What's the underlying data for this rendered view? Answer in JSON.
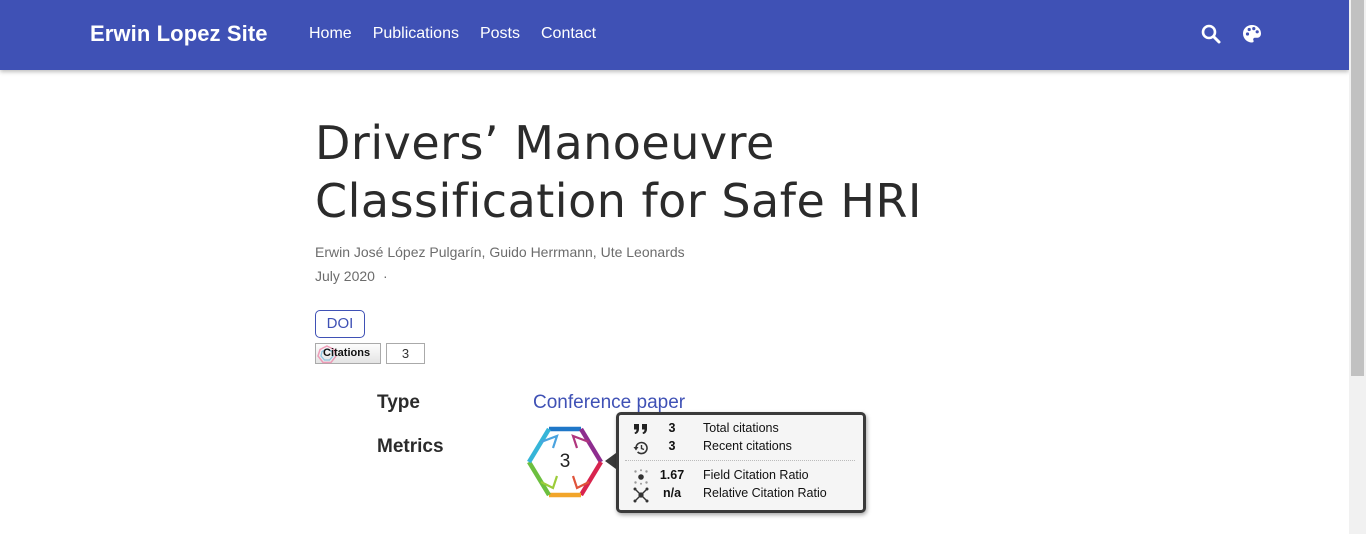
{
  "header": {
    "brand": "Erwin Lopez Site",
    "nav": [
      "Home",
      "Publications",
      "Posts",
      "Contact"
    ],
    "icons": [
      "search-icon",
      "palette-icon"
    ],
    "bg_color": "#3f51b5"
  },
  "publication": {
    "title_line1": "Drivers’ Manoeuvre",
    "title_line2": "Classification for Safe HRI",
    "authors": "Erwin José López Pulgarín, Guido Herrmann, Ute Leonards",
    "date": "July 2020",
    "date_sep": "·",
    "doi_label": "DOI"
  },
  "citation_badge": {
    "label": "Citations",
    "count": "3"
  },
  "meta": {
    "type_label": "Type",
    "type_value": "Conference paper",
    "metrics_label": "Metrics"
  },
  "metrics_popup": {
    "badge_number": "3",
    "rows": [
      {
        "icon": "quote-icon",
        "value": "3",
        "label": "Total citations"
      },
      {
        "icon": "history-icon",
        "value": "3",
        "label": "Recent citations"
      },
      {
        "icon": "network-icon",
        "value": "1.67",
        "label": "Field Citation Ratio"
      },
      {
        "icon": "network-burst-icon",
        "value": "n/a",
        "label": "Relative Citation Ratio"
      }
    ]
  }
}
